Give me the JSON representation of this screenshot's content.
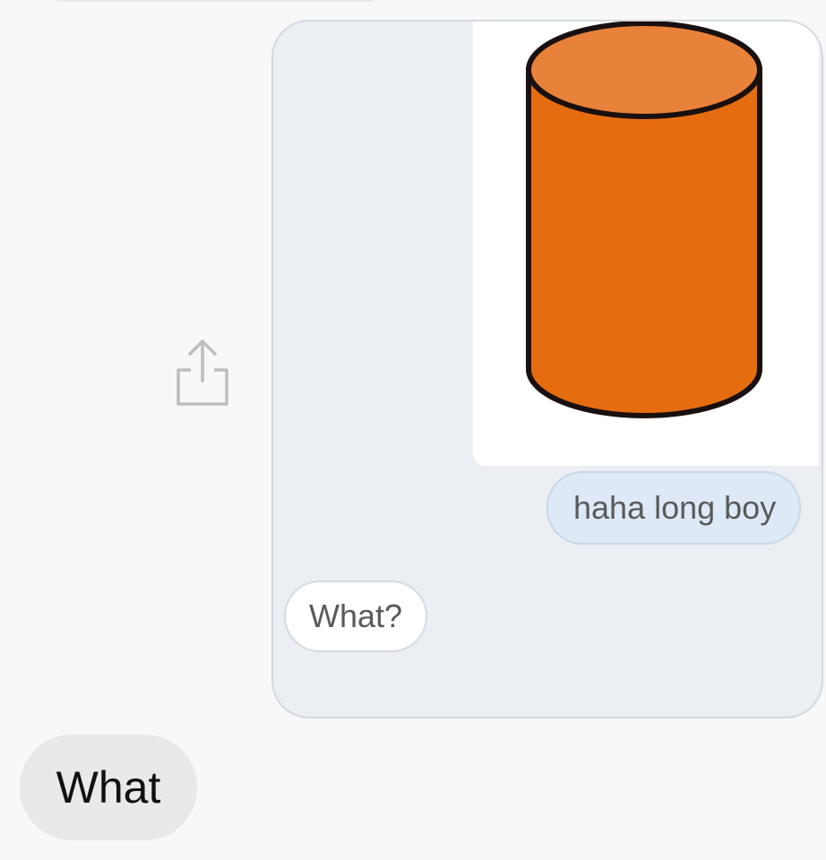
{
  "thread": {
    "shared_message": {
      "image_description": "orange-cylinder",
      "image_color": "#e8700f",
      "caption": "haha long boy",
      "reply": "What?"
    },
    "outgoing_message": "What",
    "share_icon": "share-icon"
  },
  "colors": {
    "card_background": "#ebeef3",
    "sent_bubble": "#dde9f6",
    "my_bubble": "#e9e9e9"
  }
}
